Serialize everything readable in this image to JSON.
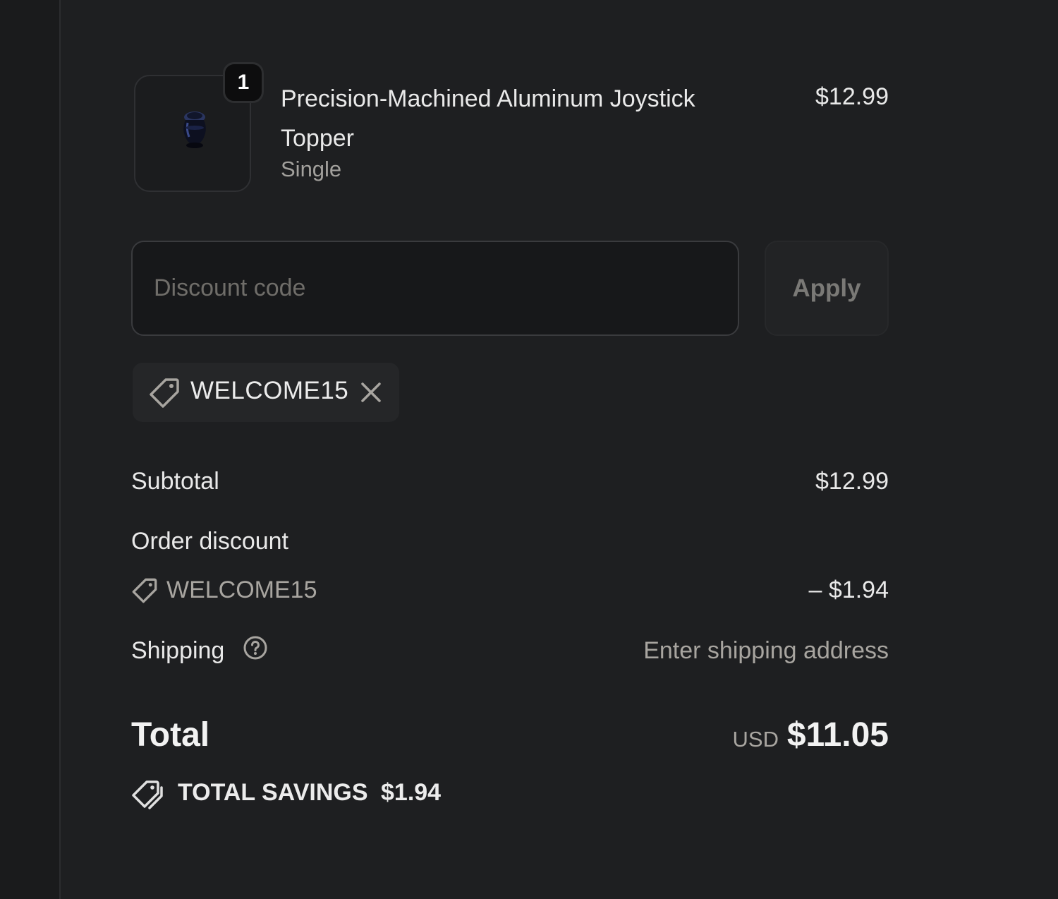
{
  "cart": {
    "product": {
      "quantity": "1",
      "name": "Precision-Machined Aluminum Joystick Topper",
      "variant": "Single",
      "price": "$12.99",
      "image_icon": "joystick-topper-image"
    }
  },
  "discount": {
    "placeholder": "Discount code",
    "apply_label": "Apply",
    "applied_code": "WELCOME15"
  },
  "summary": {
    "subtotal_label": "Subtotal",
    "subtotal_value": "$12.99",
    "order_discount_label": "Order discount",
    "order_discount_code": "WELCOME15",
    "order_discount_value": "– $1.94",
    "shipping_label": "Shipping",
    "shipping_value": "Enter shipping address",
    "total_label": "Total",
    "currency": "USD",
    "total_value": "$11.05",
    "savings_label": "TOTAL SAVINGS",
    "savings_value": "$1.94"
  },
  "colors": {
    "background": "#1e1f21",
    "text": "#e9e9e9",
    "muted_text": "#a8a5a0",
    "input_background": "#17181a"
  }
}
